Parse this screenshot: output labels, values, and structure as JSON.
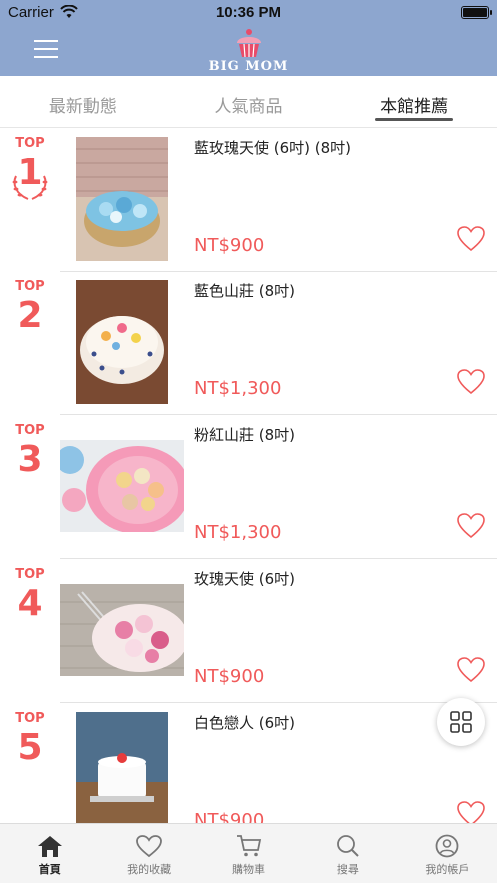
{
  "status_bar": {
    "carrier": "Carrier",
    "time": "10:36 PM"
  },
  "header": {
    "brand": "BIG MOM",
    "logo_icon": "cupcake-logo",
    "menu_icon": "hamburger-menu-icon"
  },
  "tabs": [
    {
      "label": "最新動態",
      "active": false
    },
    {
      "label": "人氣商品",
      "active": false
    },
    {
      "label": "本館推薦",
      "active": true
    }
  ],
  "products": [
    {
      "rank_label": "TOP",
      "rank": "1",
      "name": "藍玫瑰天使 (6吋) (8吋)",
      "price": "NT$900",
      "favorite_icon": "heart-outline-icon"
    },
    {
      "rank_label": "TOP",
      "rank": "2",
      "name": "藍色山莊 (8吋)",
      "price": "NT$1,300",
      "favorite_icon": "heart-outline-icon"
    },
    {
      "rank_label": "TOP",
      "rank": "3",
      "name": "粉紅山莊 (8吋)",
      "price": "NT$1,300",
      "favorite_icon": "heart-outline-icon"
    },
    {
      "rank_label": "TOP",
      "rank": "4",
      "name": "玫瑰天使 (6吋)",
      "price": "NT$900",
      "favorite_icon": "heart-outline-icon"
    },
    {
      "rank_label": "TOP",
      "rank": "5",
      "name": "白色戀人 (6吋)",
      "price": "NT$900",
      "favorite_icon": "heart-outline-icon"
    }
  ],
  "bottom_tabs": [
    {
      "label": "首頁",
      "icon": "home-icon",
      "active": true
    },
    {
      "label": "我的收藏",
      "icon": "heart-icon",
      "active": false
    },
    {
      "label": "購物車",
      "icon": "cart-icon",
      "active": false
    },
    {
      "label": "搜尋",
      "icon": "search-icon",
      "active": false
    },
    {
      "label": "我的帳戶",
      "icon": "user-icon",
      "active": false
    }
  ],
  "colors": {
    "header": "#8da6cf",
    "accent": "#f05a5a"
  }
}
